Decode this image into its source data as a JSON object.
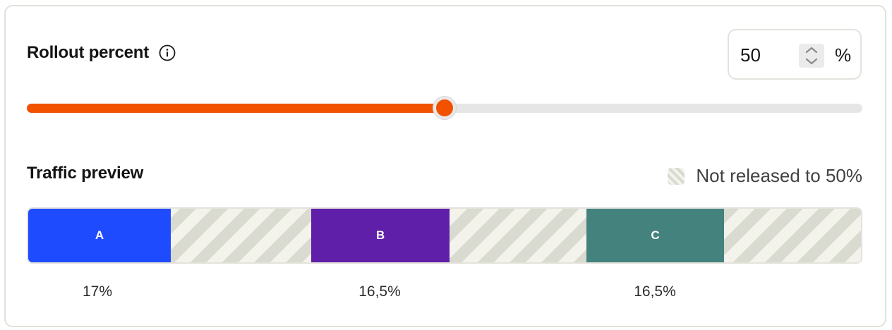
{
  "rollout": {
    "title": "Rollout percent",
    "value": "50",
    "unit": "%",
    "percent": 50,
    "info_icon": "info-circle-icon"
  },
  "colors": {
    "accent": "#f25100",
    "track": "#e6e6e6",
    "variant_a": "#1f4bff",
    "variant_b": "#5f1fa8",
    "variant_c": "#43827d",
    "stripe_light": "#f3f3ec",
    "stripe_dark": "#d9dad0"
  },
  "preview": {
    "title": "Traffic preview",
    "legend_label": "Not released to 50%",
    "legend_icon": "striped-swatch-icon",
    "segments": [
      {
        "label": "A",
        "share": "17%"
      },
      {
        "label": "B",
        "share": "16,5%"
      },
      {
        "label": "C",
        "share": "16,5%"
      }
    ]
  }
}
